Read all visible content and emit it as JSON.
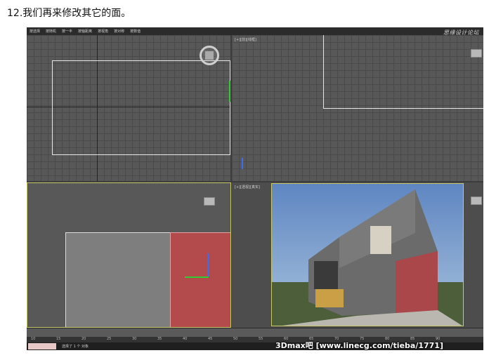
{
  "caption": "12.我们再来修改其它的面。",
  "menu": [
    "按选择",
    "按随机",
    "按一半",
    "按轴距离",
    "按视角",
    "按对称",
    "按数值"
  ],
  "brand": "思缘设计论坛",
  "viewports": {
    "top_right_label": "[+][前][线框]",
    "bottom_left_label": "",
    "bottom_mid_label": "[+][透视][真实]"
  },
  "ruler_ticks": [
    "10",
    "15",
    "20",
    "25",
    "30",
    "35",
    "40",
    "45",
    "50",
    "55",
    "60",
    "65",
    "70",
    "75",
    "80",
    "85",
    "90"
  ],
  "status": {
    "text": "选择了 1 个 对象"
  },
  "watermark": "3Dmax吧  [www.linecg.com/tieba/1771]",
  "colors": {
    "viewport": "#585858",
    "selection": "#c0393b",
    "frame": "#3c3c3c"
  }
}
